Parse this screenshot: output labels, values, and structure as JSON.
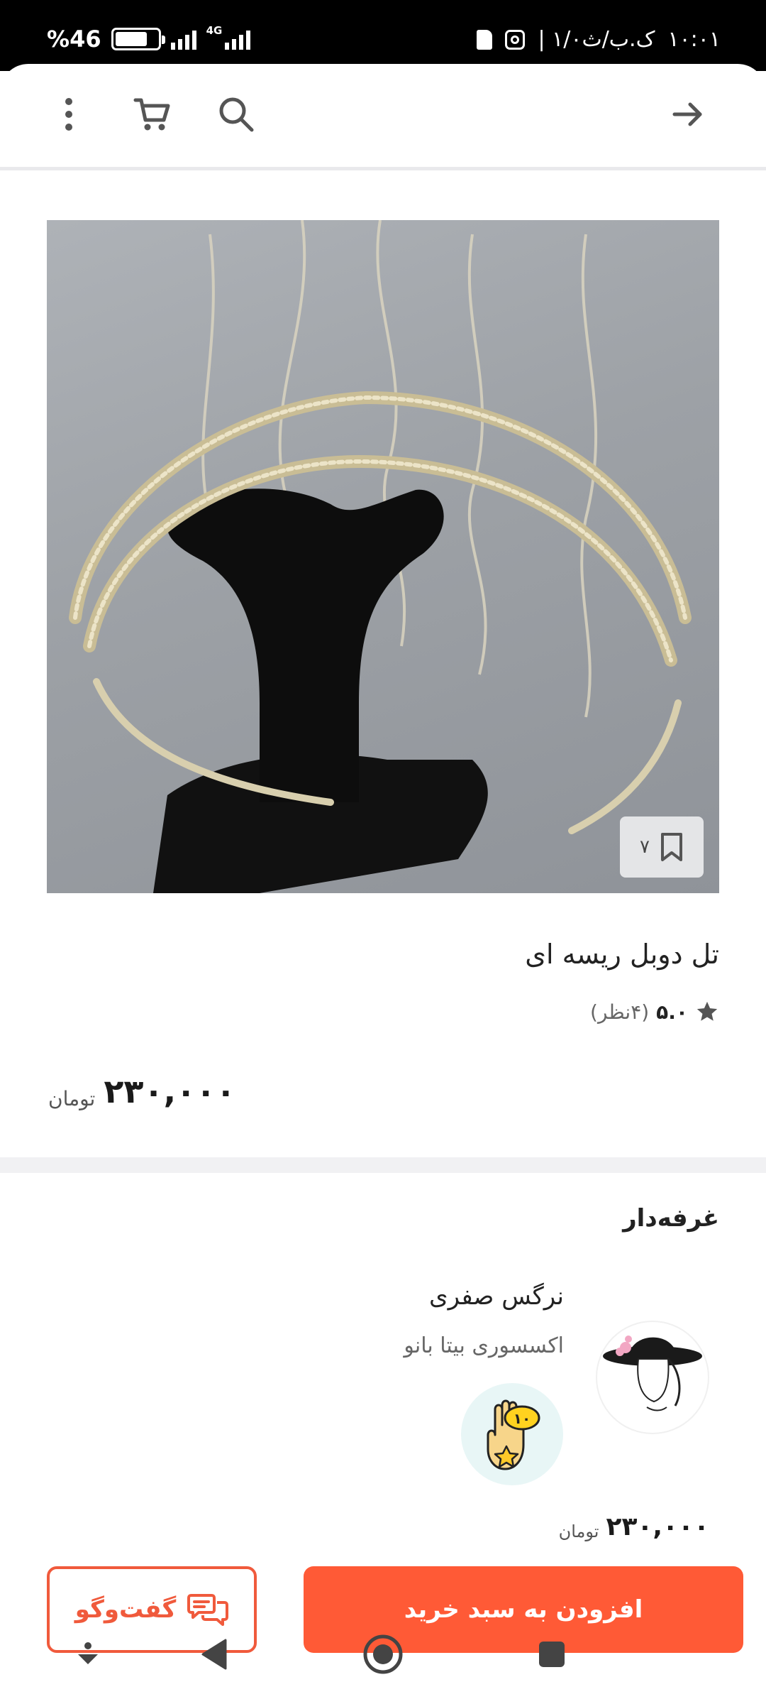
{
  "status_bar": {
    "battery_percent": "%46",
    "network": "4G",
    "time": "۱۰:۰۱",
    "info": "| ۱/۰ک.ب/ث"
  },
  "toolbar": {
    "back_icon": "arrow-right-icon",
    "search_icon": "search-icon",
    "cart_icon": "cart-icon",
    "more_icon": "more-vert-icon"
  },
  "product": {
    "bookmark_count": "۷",
    "title": "تل دوبل ریسه ای",
    "rating_score": "۵.۰",
    "rating_count": "(۴نظر)",
    "price": "۲۳۰,۰۰۰",
    "currency": "تومان"
  },
  "seller_section": {
    "title": "غرفه‌دار",
    "name": "نرگس صفری",
    "shop": "اکسسوری بیتا بانو",
    "badge_number": "۱۰",
    "price": "۲۳۰,۰۰۰",
    "currency": "تومان"
  },
  "actions": {
    "chat_label": "گفت‌وگو",
    "add_to_cart_label": "افزودن به سبد خرید"
  },
  "colors": {
    "accent": "#ff5a36",
    "accent_border": "#f05a3c"
  }
}
